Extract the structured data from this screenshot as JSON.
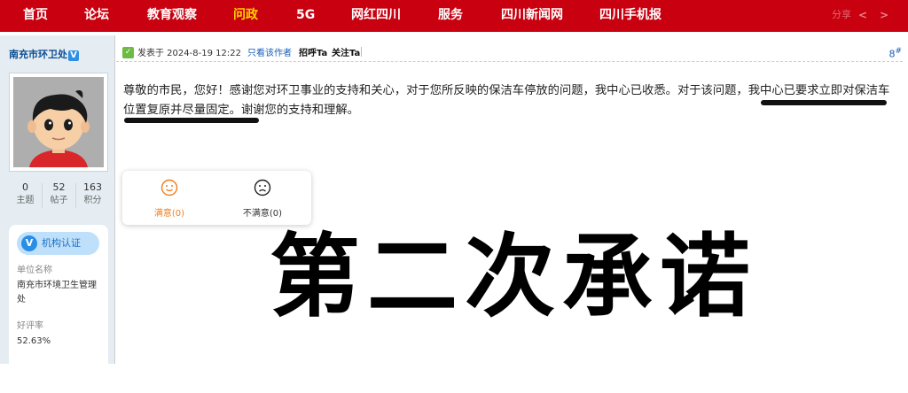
{
  "nav": {
    "items": [
      "首页",
      "论坛",
      "教育观察",
      "问政",
      "5G",
      "网红四川",
      "服务",
      "四川新闻网",
      "四川手机报"
    ],
    "active_index": 3,
    "faint_right": "分享",
    "accent": "#c8000f",
    "active_color": "#ffd200"
  },
  "sidebar": {
    "username": "南充市环卫处",
    "verified_mark": "V",
    "stats": [
      {
        "value": "0",
        "label": "主题"
      },
      {
        "value": "52",
        "label": "帖子"
      },
      {
        "value": "163",
        "label": "积分"
      }
    ],
    "certification": {
      "badge_icon": "V",
      "badge_label": "机构认证",
      "unit_label": "单位名称",
      "unit_value": "南充市环境卫生管理处",
      "rating_label": "好评率",
      "rating_value": "52.63%"
    }
  },
  "post": {
    "posted_at": "发表于 2024-8-19 12:22",
    "only_author": "只看该作者",
    "greet": "招呼Ta",
    "follow": "关注Ta",
    "floor": "8",
    "floor_mark": "#",
    "body": "尊敬的市民，您好！感谢您对环卫事业的支持和关心，对于您所反映的保洁车停放的问题，我中心已收悉。对于该问题，我中心已要求立即对保洁车位置复原并尽量固定。谢谢您的支持和理解。"
  },
  "rating": {
    "satisfied": "满意(0)",
    "unsatisfied": "不满意(0)",
    "satisfied_color": "#f07d1e"
  },
  "overlay_caption": "第二次承诺"
}
